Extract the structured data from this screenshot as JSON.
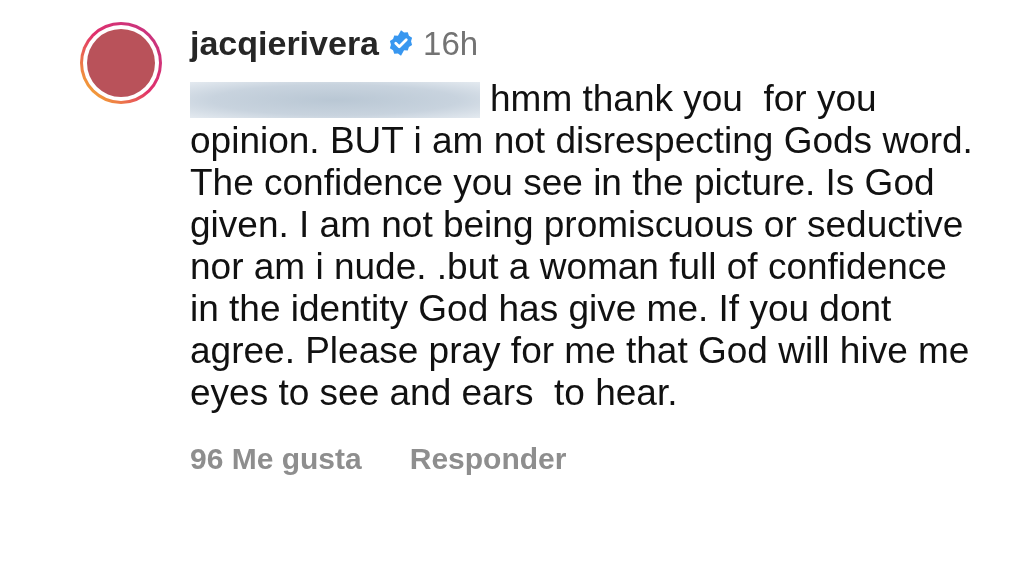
{
  "comment": {
    "username": "jacqierivera",
    "verified": true,
    "time": "16h",
    "text": "hmm thank you  for you opinion. BUT i am not disrespecting Gods word.  The confidence you see in the picture. Is God given. I am not being promiscuous or seductive nor am i nude. .but a woman full of confidence in the identity God has give me. If you dont agree. Please pray for me that God will hive me eyes to see and ears  to hear.",
    "likes": "96 Me gusta",
    "reply": "Responder"
  }
}
